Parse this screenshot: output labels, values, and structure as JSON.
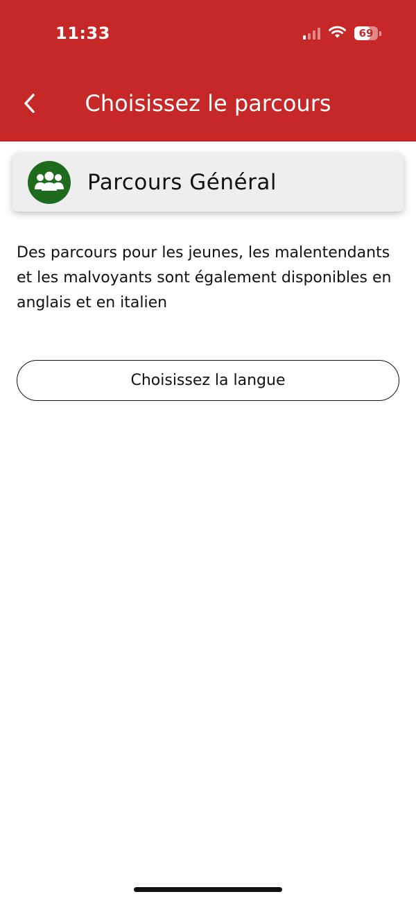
{
  "status_bar": {
    "time": "11:33",
    "battery_level": "69",
    "signal_bars_active": 1,
    "signal_bars_total": 4,
    "icons": [
      "cellular-signal-icon",
      "wifi-icon",
      "battery-icon"
    ]
  },
  "header": {
    "title": "Choisissez le parcours",
    "back_icon": "chevron-left-icon"
  },
  "route_card": {
    "label": "Parcours Général",
    "icon": "group-icon"
  },
  "description": "Des parcours pour les jeunes, les malentendants et les malvoyants sont également disponibles en anglais et en italien",
  "language_button": {
    "label": "Choisissez la langue"
  },
  "colors": {
    "header_background": "#c62828",
    "icon_circle": "#1e6b1e",
    "card_background": "#eeeeee",
    "text": "#111111"
  }
}
